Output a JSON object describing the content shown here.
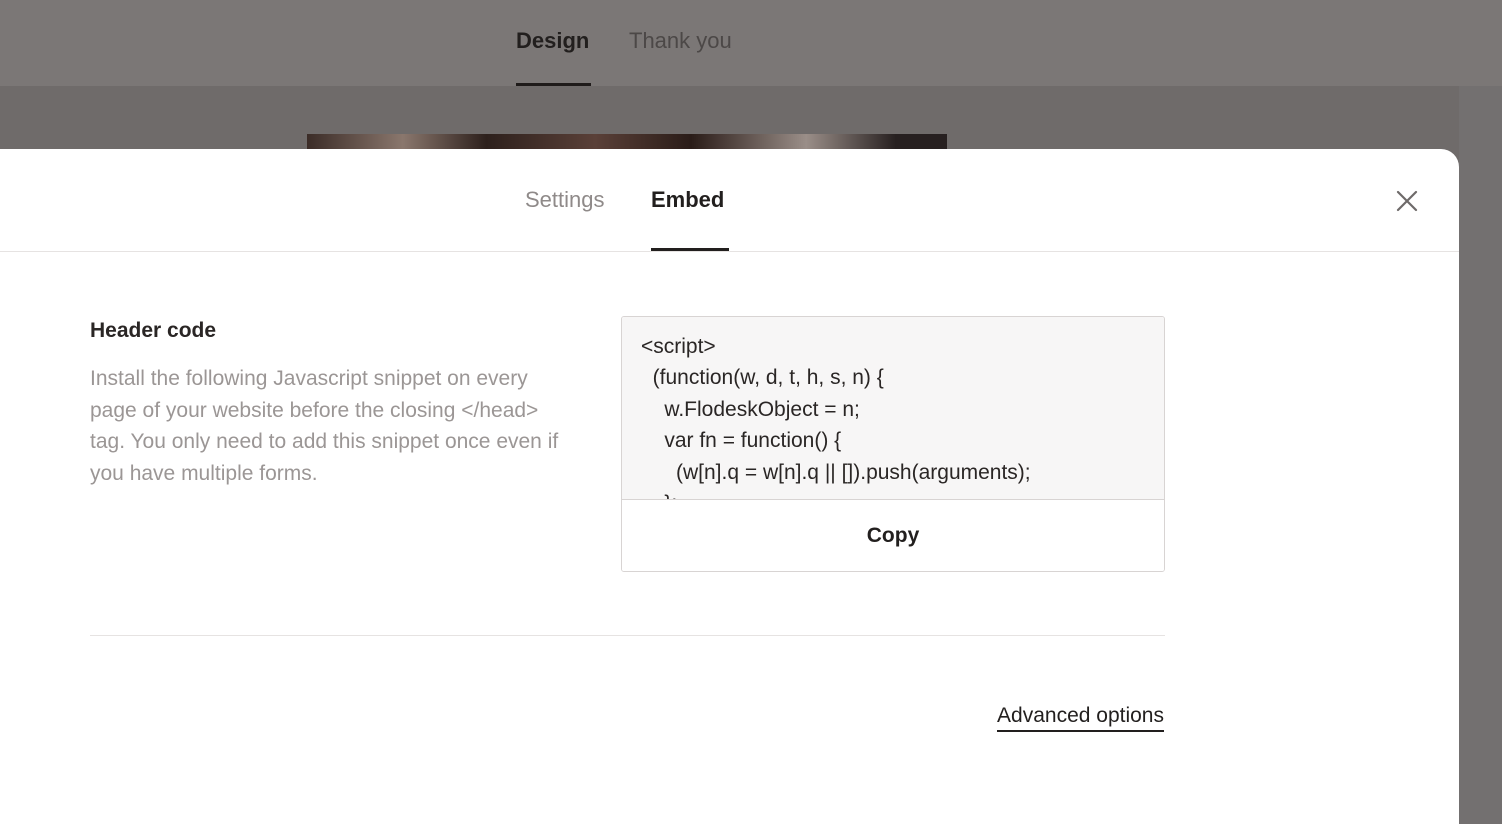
{
  "background_page": {
    "tabs": [
      {
        "label": "Design",
        "active": true
      },
      {
        "label": "Thank you",
        "active": false
      }
    ]
  },
  "modal": {
    "tabs": [
      {
        "label": "Settings",
        "active": false
      },
      {
        "label": "Embed",
        "active": true
      }
    ],
    "close_icon": "close-icon",
    "header_code": {
      "title": "Header code",
      "description": "Install the following Javascript snippet on every page of your website before the closing </head> tag. You only need to add this snippet once even if you have multiple forms.",
      "code": "<script>\n  (function(w, d, t, h, s, n) {\n    w.FlodeskObject = n;\n    var fn = function() {\n      (w[n].q = w[n].q || []).push(arguments);\n    };",
      "copy_label": "Copy"
    },
    "advanced_options_label": "Advanced options"
  },
  "colors": {
    "overlay": "#7a7574",
    "text_primary": "#221f1e",
    "text_muted": "#9b9695",
    "border": "#d8d4d3"
  }
}
